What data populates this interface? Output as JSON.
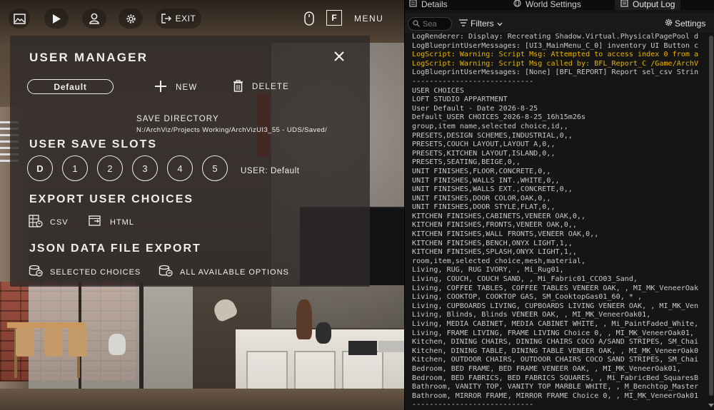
{
  "toolbar": {
    "exit_label": "EXIT",
    "fullscreen_key": "F",
    "menu_label": "MENU"
  },
  "user_manager": {
    "title": "USER MANAGER",
    "profile_selector": "Default",
    "new_label": "NEW",
    "delete_label": "DELETE",
    "save_directory_label": "SAVE DIRECTORY",
    "save_directory_path": "N:/ArchViz/Projects Working/ArchVizUI3_55 - UDS/Saved/",
    "save_slots_heading": "USER SAVE SLOTS",
    "slots": [
      "D",
      "1",
      "2",
      "3",
      "4",
      "5"
    ],
    "current_user": "USER: Default",
    "export_heading": "EXPORT USER CHOICES",
    "export_csv": "CSV",
    "export_html": "HTML",
    "json_heading": "JSON DATA FILE EXPORT",
    "json_selected": "SELECTED CHOICES",
    "json_all": "ALL AVAILABLE OPTIONS"
  },
  "editor": {
    "tabs": [
      "Details",
      "World Settings",
      "Output Log"
    ],
    "active_tab": "Output Log",
    "search_placeholder": "Sea",
    "filters_label": "Filters",
    "settings_label": "Settings",
    "log_lines": [
      {
        "text": "LogRenderer: Display: Recreating Shadow.Virtual.PhysicalPagePool d",
        "level": "info"
      },
      {
        "text": "LogBlueprintUserMessages: [UI3_MainMenu_C_0] inventory UI Button c",
        "level": "info"
      },
      {
        "text": "LogScript: Warning: Script Msg: Attempted to access index 0 from a",
        "level": "warn"
      },
      {
        "text": "LogScript: Warning: Script Msg called by: BFL_Report_C /Game/ArchV",
        "level": "warn"
      },
      {
        "text": "LogBlueprintUserMessages: [None] [BFL_REPORT] Report sel_csv Strin",
        "level": "info"
      },
      {
        "text": "----------------------------",
        "level": "info"
      },
      {
        "text": "USER CHOICES",
        "level": "info"
      },
      {
        "text": "LOFT STUDIO APPARTMENT",
        "level": "info"
      },
      {
        "text": "User Default - Date 2026-8-25",
        "level": "info"
      },
      {
        "text": "Default_USER CHOICES_2026-8-25_16h15m26s",
        "level": "info"
      },
      {
        "text": "group,item name,selected choice,id,,",
        "level": "info"
      },
      {
        "text": "PRESETS,DESIGN SCHEMES,INDUSTRIAL,0,,",
        "level": "info"
      },
      {
        "text": "PRESETS,COUCH LAYOUT,LAYOUT A,0,,",
        "level": "info"
      },
      {
        "text": "PRESETS,KITCHEN LAYOUT,ISLAND,0,,",
        "level": "info"
      },
      {
        "text": "PRESETS,SEATING,BEIGE,0,,",
        "level": "info"
      },
      {
        "text": "UNIT FINISHES,FLOOR,CONCRETE,0,,",
        "level": "info"
      },
      {
        "text": "UNIT FINISHES,WALLS INT.,WHITE,0,,",
        "level": "info"
      },
      {
        "text": "UNIT FINISHES,WALLS EXT.,CONCRETE,0,,",
        "level": "info"
      },
      {
        "text": "UNIT FINISHES,DOOR COLOR,OAK,0,,",
        "level": "info"
      },
      {
        "text": "UNIT FINISHES,DOOR STYLE,FLAT,0,,",
        "level": "info"
      },
      {
        "text": "KITCHEN FINISHES,CABINETS,VENEER OAK,0,,",
        "level": "info"
      },
      {
        "text": "KITCHEN FINISHES,FRONTS,VENEER OAK,0,,",
        "level": "info"
      },
      {
        "text": "KITCHEN FINISHES,WALL FRONTS,VENEER OAK,0,,",
        "level": "info"
      },
      {
        "text": "KITCHEN FINISHES,BENCH,ONYX LIGHT,1,,",
        "level": "info"
      },
      {
        "text": "KITCHEN FINISHES,SPLASH,ONYX LIGHT,1,,",
        "level": "info"
      },
      {
        "text": "room,item,selected choice,mesh,material,",
        "level": "info"
      },
      {
        "text": "Living, RUG, RUG IVORY, , Mi_Rug01,",
        "level": "info"
      },
      {
        "text": "Living, COUCH, COUCH SAND, , Mi_Fabric01_CCO03_Sand,",
        "level": "info"
      },
      {
        "text": "Living, COFFEE TABLES, COFFEE TABLES VENEER OAK, , MI_MK_VeneerOak",
        "level": "info"
      },
      {
        "text": "Living, COOKTOP, COOKTOP GAS, SM_CooktopGas01_60, * ,",
        "level": "info"
      },
      {
        "text": "Living, CUPBOARDS LIVING, CUPBOARDS LIVING VENEER OAK, , MI_MK_Ven",
        "level": "info"
      },
      {
        "text": "Living, Blinds, Blinds VENEER OAK, , MI_MK_VeneerOak01,",
        "level": "info"
      },
      {
        "text": "Living, MEDIA CABINET, MEDIA CABINET WHITE, , Mi_PaintFaded_White,",
        "level": "info"
      },
      {
        "text": "Living, FRAME LIVING, FRAME LIVING Choice 0, , MI_MK_VeneerOak01,",
        "level": "info"
      },
      {
        "text": "Kitchen, DINING CHAIRS, DINING CHAIRS COCO A/SAND STRIPES, SM_Chai",
        "level": "info"
      },
      {
        "text": "Kitchen, DINING TABLE, DINING TABLE VENEER OAK, , MI_MK_VeneerOak0",
        "level": "info"
      },
      {
        "text": "Kitchen, OUTDOOR CHAIRS, OUTDOOR CHAIRS COCO SAND STRIPES, SM_Chai",
        "level": "info"
      },
      {
        "text": "Bedroom, BED FRAME, BED FRAME VENEER OAK, , MI_MK_VeneerOak01,",
        "level": "info"
      },
      {
        "text": "Bedroom, BED FABRICS, BED FABRICS SQUARES, , Mi_FabricBed_SquaresB",
        "level": "info"
      },
      {
        "text": "Bathroom, VANITY TOP, VANITY TOP MARBLE WHITE, , M_Benchtop_Master",
        "level": "info"
      },
      {
        "text": "Bathroom, MIRROR FRAME, MIRROR FRAME Choice 0, , MI_MK_VeneerOak01",
        "level": "info"
      },
      {
        "text": "----------------------------",
        "level": "info"
      }
    ]
  }
}
